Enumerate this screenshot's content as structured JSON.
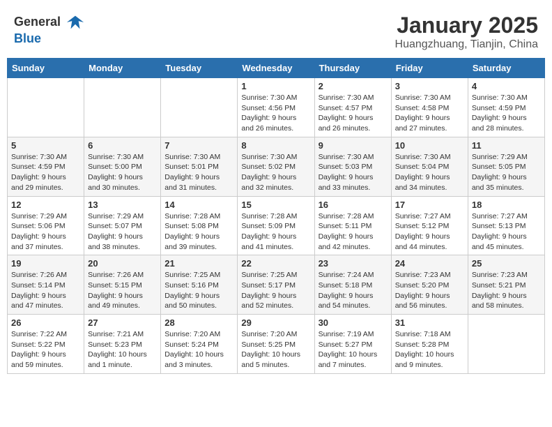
{
  "header": {
    "logo_line1": "General",
    "logo_line2": "Blue",
    "title": "January 2025",
    "subtitle": "Huangzhuang, Tianjin, China"
  },
  "weekdays": [
    "Sunday",
    "Monday",
    "Tuesday",
    "Wednesday",
    "Thursday",
    "Friday",
    "Saturday"
  ],
  "weeks": [
    [
      {
        "date": "",
        "info": ""
      },
      {
        "date": "",
        "info": ""
      },
      {
        "date": "",
        "info": ""
      },
      {
        "date": "1",
        "info": "Sunrise: 7:30 AM\nSunset: 4:56 PM\nDaylight: 9 hours\nand 26 minutes."
      },
      {
        "date": "2",
        "info": "Sunrise: 7:30 AM\nSunset: 4:57 PM\nDaylight: 9 hours\nand 26 minutes."
      },
      {
        "date": "3",
        "info": "Sunrise: 7:30 AM\nSunset: 4:58 PM\nDaylight: 9 hours\nand 27 minutes."
      },
      {
        "date": "4",
        "info": "Sunrise: 7:30 AM\nSunset: 4:59 PM\nDaylight: 9 hours\nand 28 minutes."
      }
    ],
    [
      {
        "date": "5",
        "info": "Sunrise: 7:30 AM\nSunset: 4:59 PM\nDaylight: 9 hours\nand 29 minutes."
      },
      {
        "date": "6",
        "info": "Sunrise: 7:30 AM\nSunset: 5:00 PM\nDaylight: 9 hours\nand 30 minutes."
      },
      {
        "date": "7",
        "info": "Sunrise: 7:30 AM\nSunset: 5:01 PM\nDaylight: 9 hours\nand 31 minutes."
      },
      {
        "date": "8",
        "info": "Sunrise: 7:30 AM\nSunset: 5:02 PM\nDaylight: 9 hours\nand 32 minutes."
      },
      {
        "date": "9",
        "info": "Sunrise: 7:30 AM\nSunset: 5:03 PM\nDaylight: 9 hours\nand 33 minutes."
      },
      {
        "date": "10",
        "info": "Sunrise: 7:30 AM\nSunset: 5:04 PM\nDaylight: 9 hours\nand 34 minutes."
      },
      {
        "date": "11",
        "info": "Sunrise: 7:29 AM\nSunset: 5:05 PM\nDaylight: 9 hours\nand 35 minutes."
      }
    ],
    [
      {
        "date": "12",
        "info": "Sunrise: 7:29 AM\nSunset: 5:06 PM\nDaylight: 9 hours\nand 37 minutes."
      },
      {
        "date": "13",
        "info": "Sunrise: 7:29 AM\nSunset: 5:07 PM\nDaylight: 9 hours\nand 38 minutes."
      },
      {
        "date": "14",
        "info": "Sunrise: 7:28 AM\nSunset: 5:08 PM\nDaylight: 9 hours\nand 39 minutes."
      },
      {
        "date": "15",
        "info": "Sunrise: 7:28 AM\nSunset: 5:09 PM\nDaylight: 9 hours\nand 41 minutes."
      },
      {
        "date": "16",
        "info": "Sunrise: 7:28 AM\nSunset: 5:11 PM\nDaylight: 9 hours\nand 42 minutes."
      },
      {
        "date": "17",
        "info": "Sunrise: 7:27 AM\nSunset: 5:12 PM\nDaylight: 9 hours\nand 44 minutes."
      },
      {
        "date": "18",
        "info": "Sunrise: 7:27 AM\nSunset: 5:13 PM\nDaylight: 9 hours\nand 45 minutes."
      }
    ],
    [
      {
        "date": "19",
        "info": "Sunrise: 7:26 AM\nSunset: 5:14 PM\nDaylight: 9 hours\nand 47 minutes."
      },
      {
        "date": "20",
        "info": "Sunrise: 7:26 AM\nSunset: 5:15 PM\nDaylight: 9 hours\nand 49 minutes."
      },
      {
        "date": "21",
        "info": "Sunrise: 7:25 AM\nSunset: 5:16 PM\nDaylight: 9 hours\nand 50 minutes."
      },
      {
        "date": "22",
        "info": "Sunrise: 7:25 AM\nSunset: 5:17 PM\nDaylight: 9 hours\nand 52 minutes."
      },
      {
        "date": "23",
        "info": "Sunrise: 7:24 AM\nSunset: 5:18 PM\nDaylight: 9 hours\nand 54 minutes."
      },
      {
        "date": "24",
        "info": "Sunrise: 7:23 AM\nSunset: 5:20 PM\nDaylight: 9 hours\nand 56 minutes."
      },
      {
        "date": "25",
        "info": "Sunrise: 7:23 AM\nSunset: 5:21 PM\nDaylight: 9 hours\nand 58 minutes."
      }
    ],
    [
      {
        "date": "26",
        "info": "Sunrise: 7:22 AM\nSunset: 5:22 PM\nDaylight: 9 hours\nand 59 minutes."
      },
      {
        "date": "27",
        "info": "Sunrise: 7:21 AM\nSunset: 5:23 PM\nDaylight: 10 hours\nand 1 minute."
      },
      {
        "date": "28",
        "info": "Sunrise: 7:20 AM\nSunset: 5:24 PM\nDaylight: 10 hours\nand 3 minutes."
      },
      {
        "date": "29",
        "info": "Sunrise: 7:20 AM\nSunset: 5:25 PM\nDaylight: 10 hours\nand 5 minutes."
      },
      {
        "date": "30",
        "info": "Sunrise: 7:19 AM\nSunset: 5:27 PM\nDaylight: 10 hours\nand 7 minutes."
      },
      {
        "date": "31",
        "info": "Sunrise: 7:18 AM\nSunset: 5:28 PM\nDaylight: 10 hours\nand 9 minutes."
      },
      {
        "date": "",
        "info": ""
      }
    ]
  ]
}
